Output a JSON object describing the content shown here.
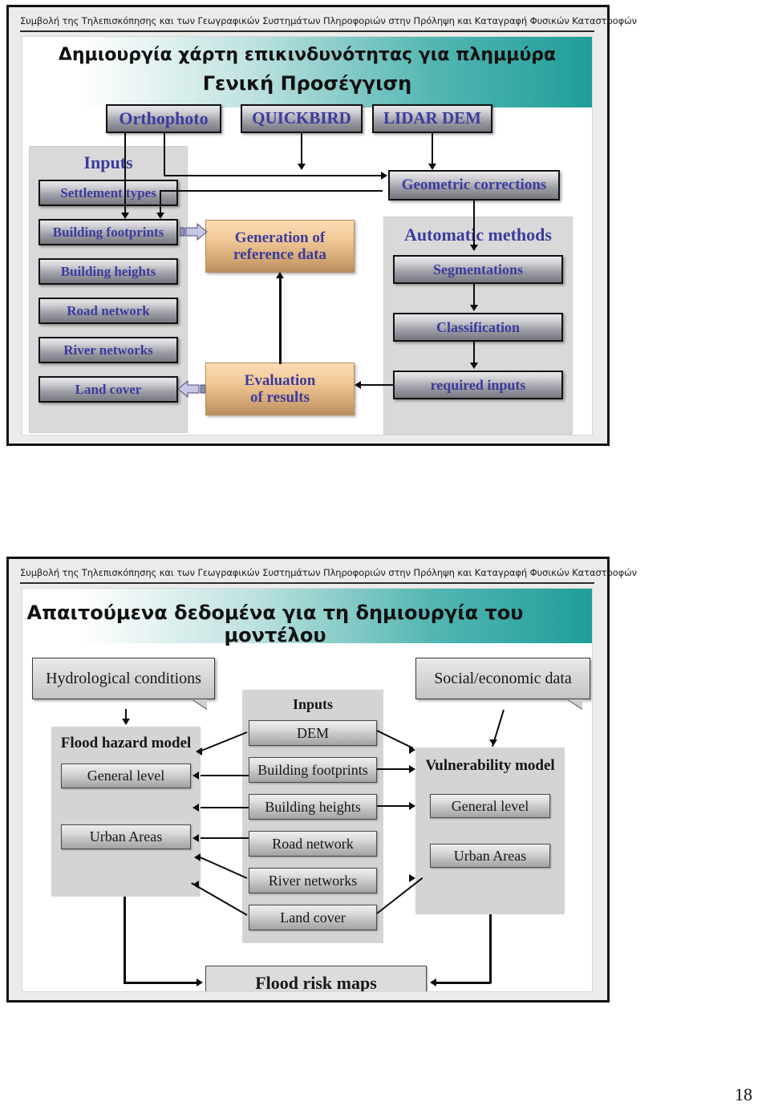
{
  "document": {
    "page_number": "18",
    "running_header": "Συμβολή της Τηλεπισκόπησης και των Γεωγραφικών Συστημάτων Πληροφοριών στην Πρόληψη και Καταγραφή Φυσικών Καταστροφών"
  },
  "colors": {
    "banner_teal": "#1f9e99",
    "text_blue": "#3b3b9c",
    "tan": "#f2c896",
    "grey_panel": "#d9d9d9",
    "frame_border": "#111111"
  },
  "slide1": {
    "header": "Συμβολή της Τηλεπισκόπησης και των Γεωγραφικών Συστημάτων Πληροφοριών στην Πρόληψη και Καταγραφή Φυσικών Καταστροφών",
    "title_line1": "Δημιουργία χάρτη επικινδυνότητας για πλημμύρα",
    "title_line2": "Γενική Προσέγγιση",
    "sources": [
      {
        "label": "Orthophoto"
      },
      {
        "label": "QUICKBIRD"
      },
      {
        "label": "LIDAR DEM"
      }
    ],
    "inputs_panel": {
      "title": "Inputs",
      "items": [
        {
          "label": "Settlement types"
        },
        {
          "label": "Building footprints"
        },
        {
          "label": "Building heights"
        },
        {
          "label": "Road network"
        },
        {
          "label": "River networks"
        },
        {
          "label": "Land cover"
        }
      ]
    },
    "process_boxes": [
      {
        "line1": "Generation of",
        "line2": "reference data"
      },
      {
        "line1": "Evaluation",
        "line2": "of results"
      }
    ],
    "geometric_corrections": "Geometric corrections",
    "automatic_panel": {
      "title": "Automatic methods",
      "items": [
        {
          "label": "Segmentations"
        },
        {
          "label": "Classification"
        },
        {
          "label": "required inputs"
        }
      ]
    }
  },
  "slide2": {
    "header": "Συμβολή της Τηλεπισκόπησης και των Γεωγραφικών Συστημάτων Πληροφοριών στην Πρόληψη και Καταγραφή Φυσικών Καταστροφών",
    "title": "Απαιτούμενα δεδομένα για τη δημιουργία του μοντέλου",
    "hydrological_callout": "Hydrological conditions",
    "social_callout": "Social/economic data",
    "flood_hazard_panel": {
      "title": "Flood hazard model",
      "items": [
        {
          "label": "General level"
        },
        {
          "label": "Urban Areas"
        }
      ]
    },
    "inputs_panel": {
      "title": "Inputs",
      "items": [
        {
          "label": "DEM"
        },
        {
          "label": "Building footprints"
        },
        {
          "label": "Building heights"
        },
        {
          "label": "Road network"
        },
        {
          "label": "River networks"
        },
        {
          "label": "Land cover"
        }
      ]
    },
    "vulnerability_panel": {
      "title": "Vulnerability model",
      "items": [
        {
          "label": "General level"
        },
        {
          "label": "Urban Areas"
        }
      ]
    },
    "output": "Flood risk maps"
  }
}
